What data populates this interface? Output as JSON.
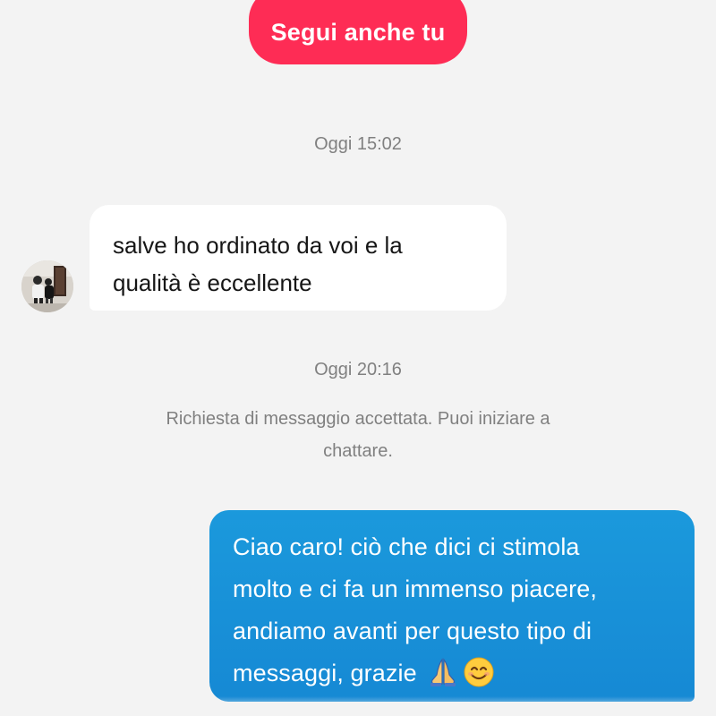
{
  "header": {
    "follow_button_label": "Segui anche tu"
  },
  "conversation": {
    "first_timestamp": "Oggi 15:02",
    "incoming_message": {
      "line1": "salve ho ordinato da voi e la",
      "line2": "qualità è eccellente"
    },
    "second_timestamp": "Oggi 20:16",
    "system_message": {
      "line1": "Richiesta di messaggio accettata. Puoi iniziare a",
      "line2": "chattare."
    },
    "outgoing_message": {
      "line1": "Ciao caro! ciò che dici ci stimola",
      "line2": "molto e ci fa un immenso piacere,",
      "line3": "andiamo avanti per questo tipo di",
      "line4": "messaggi, grazie",
      "emojis": [
        "praying-hands-icon",
        "smiling-face-icon"
      ]
    }
  },
  "colors": {
    "follow_button": "#fe2c55",
    "outgoing_bubble": "#1a94da",
    "incoming_bubble": "#ffffff",
    "background": "#f3f3f3",
    "meta_text": "#808080"
  }
}
